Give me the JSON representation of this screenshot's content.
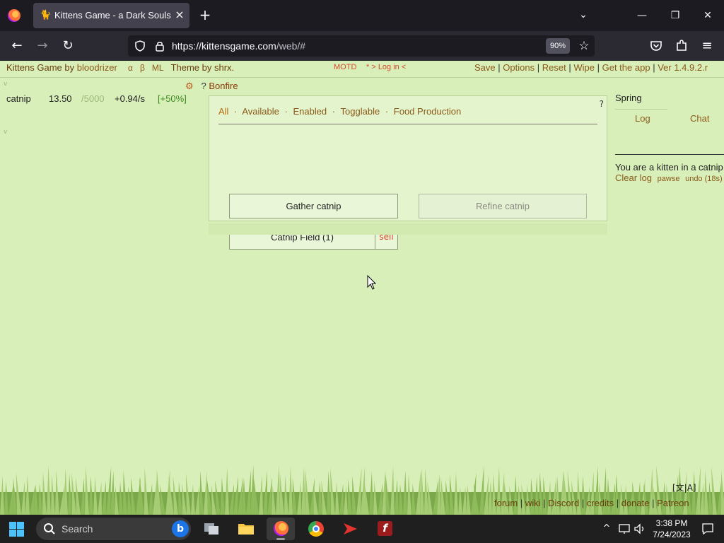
{
  "browser": {
    "tab_title": "Kittens Game - a Dark Souls of i",
    "url_main": "https://kittensgame.com",
    "url_path": "/web/#",
    "zoom": "90%"
  },
  "game": {
    "title_prefix": "Kittens Game",
    "by": "by",
    "author": "bloodrizer",
    "mini_links": [
      "α",
      "β",
      "ML"
    ],
    "theme_by": "Theme by shrx.",
    "motd": "MOTD",
    "login": "* > Log in <",
    "right_links": [
      "Save",
      "Options",
      "Reset",
      "Wipe",
      "Get the app",
      "Ver 1.4.9.2.r"
    ],
    "separator": "|"
  },
  "resources": [
    {
      "name": "catnip",
      "amount": "13.50",
      "max": "/5000",
      "rate": "+0.94/s",
      "bonus": "[+50%]"
    }
  ],
  "bonfire": {
    "gear_glyph": "⚙",
    "help_glyph": "?",
    "title": "Bonfire",
    "panel_help": "?",
    "filters": [
      "All",
      "Available",
      "Enabled",
      "Togglable",
      "Food Production"
    ],
    "filter_dot": "·",
    "gather_label": "Gather catnip",
    "refine_label": "Refine catnip",
    "field_label": "Catnip Field (1)",
    "sell_label": "sell"
  },
  "right_panel": {
    "season": "Spring",
    "tab_log": "Log",
    "tab_chat": "Chat",
    "log_message": "You are a kitten in a catnip",
    "clear_log": "Clear log",
    "pawse": "pawse",
    "undo": "undo (18s)"
  },
  "lang_button": "[文|A]",
  "footer_links": [
    "forum",
    "wiki",
    "Discord",
    "credits",
    "donate",
    "Patreon"
  ],
  "taskbar": {
    "search_label": "Search",
    "time": "3:38 PM",
    "date": "7/24/2023"
  },
  "colors": {
    "game_bg": "#d9efb9",
    "link_brown": "#8a5a1a",
    "sell_red": "#d8482c",
    "rate_green": "#3b8a20"
  }
}
